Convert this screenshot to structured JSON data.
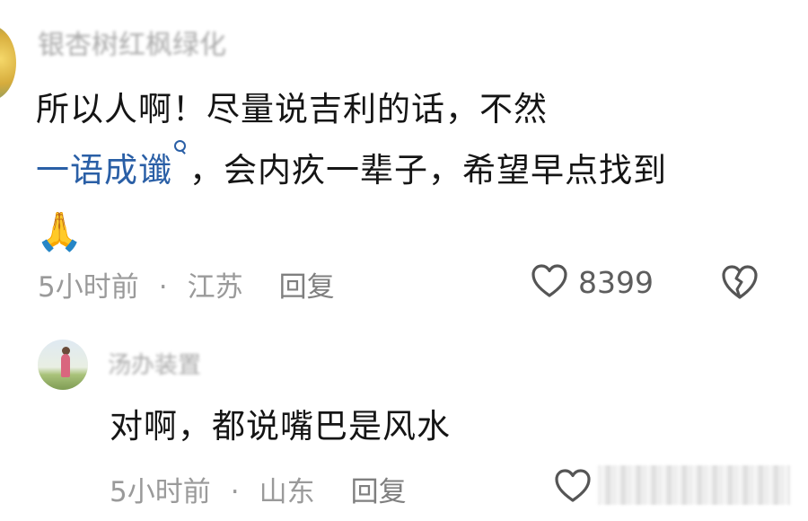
{
  "comment1": {
    "username": "银杏树红枫绿化",
    "text_line1": "所以人啊！尽量说吉利的话，不然",
    "link_text": "一语成谶",
    "text_rest": "，会内疚一辈子，希望早点找到",
    "emoji": "🙏",
    "time": "5小时前",
    "separator": "·",
    "location": "江苏",
    "reply_label": "回复",
    "likes": "8399"
  },
  "comment2": {
    "username": "汤办装置",
    "text": "对啊，都说嘴巴是风水",
    "time": "5小时前",
    "separator": "·",
    "location": "山东",
    "reply_label": "回复"
  },
  "icons": {
    "search": "search-icon",
    "like": "heart-outline-icon",
    "dislike": "broken-heart-icon"
  },
  "colors": {
    "link": "#2a5fa6",
    "meta": "#9a9a9a",
    "text": "#151515"
  }
}
